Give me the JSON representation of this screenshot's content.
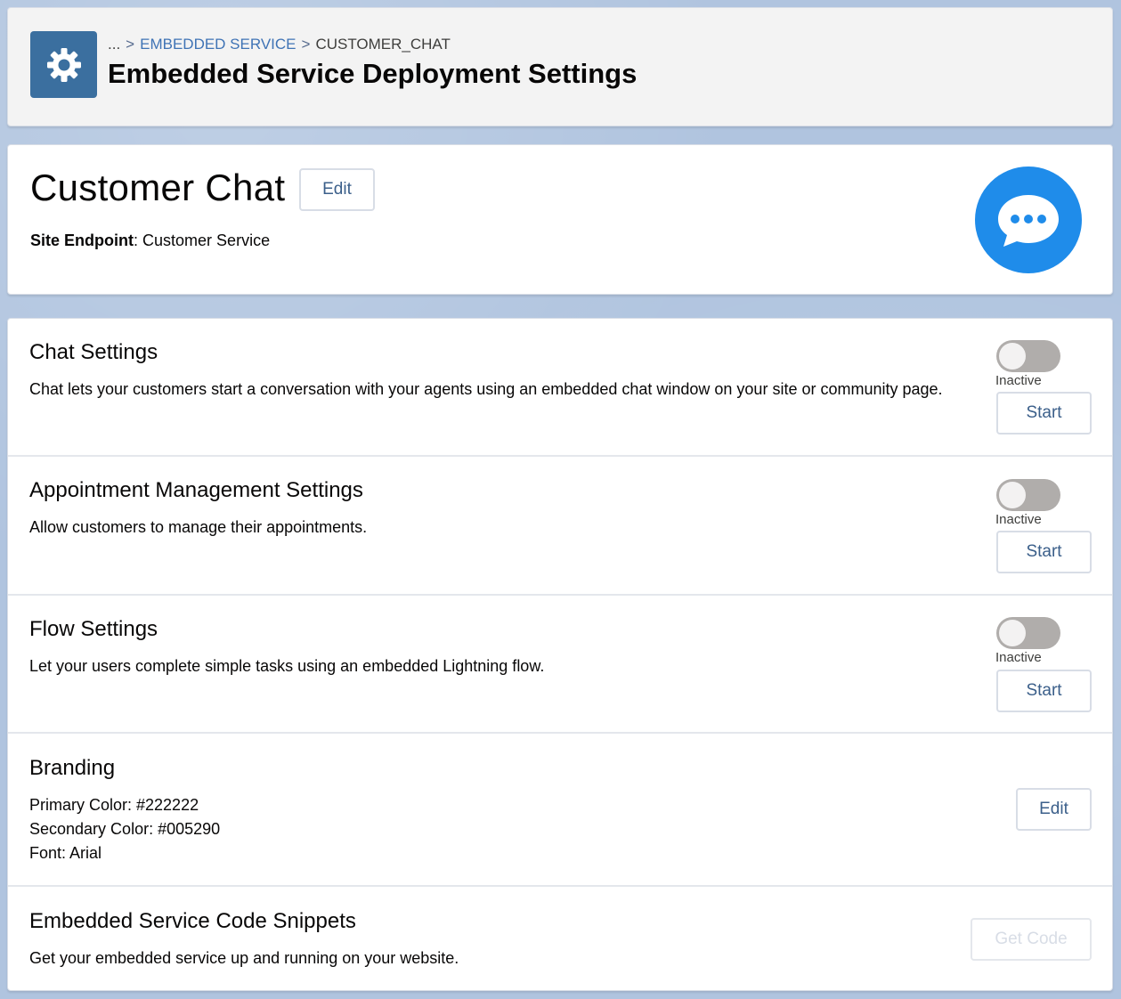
{
  "header": {
    "breadcrumb": {
      "ellipsis": "...",
      "sep": ">",
      "link": "EMBEDDED SERVICE",
      "current": "CUSTOMER_CHAT"
    },
    "title": "Embedded Service Deployment Settings",
    "icon": "gear-icon"
  },
  "record": {
    "name": "Customer Chat",
    "edit_label": "Edit",
    "endpoint_label": "Site Endpoint",
    "endpoint_sep": ":",
    "endpoint_value": "Customer Service",
    "icon": "chat-bubble-icon",
    "icon_color": "#1f8cea"
  },
  "sections": {
    "chat": {
      "title": "Chat Settings",
      "desc": "Chat lets your customers start a conversation with your agents using an embedded chat window on your site or community page.",
      "status": "Inactive",
      "button": "Start"
    },
    "appointment": {
      "title": "Appointment Management Settings",
      "desc": "Allow customers to manage their appointments.",
      "status": "Inactive",
      "button": "Start"
    },
    "flow": {
      "title": "Flow Settings",
      "desc": "Let your users complete simple tasks using an embedded Lightning flow.",
      "status": "Inactive",
      "button": "Start"
    },
    "branding": {
      "title": "Branding",
      "primary": "Primary Color: #222222",
      "secondary": "Secondary Color: #005290",
      "font": "Font: Arial",
      "button": "Edit"
    },
    "snippets": {
      "title": "Embedded Service Code Snippets",
      "desc": "Get your embedded service up and running on your website.",
      "button": "Get Code"
    }
  },
  "colors": {
    "header_icon_bg": "#3b6f9f",
    "toggle_inactive": "#b0adab",
    "link": "#3f73b5"
  }
}
